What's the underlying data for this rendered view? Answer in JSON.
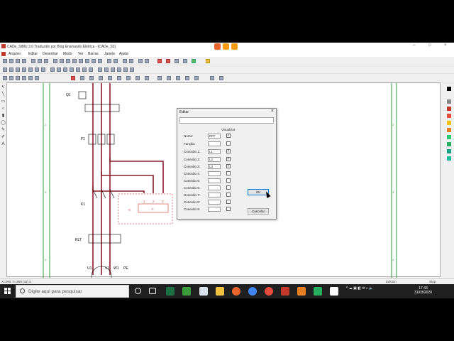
{
  "window": {
    "title": "CADe_SIMU 3.0 Traduzido por Blog Ensinando Elétrica - [CADe_S3]",
    "minimize": "–",
    "maximize": "□",
    "close": "×"
  },
  "menu": [
    "Arquivo",
    "Editar",
    "Desenhar",
    "Modo",
    "Ver",
    "Barras",
    "Janela",
    "Ajuda"
  ],
  "schematic": {
    "labels": {
      "q1": "Q1",
      "f1": "F1",
      "k1": "K1",
      "rlt": "RLT",
      "pe": "PE",
      "u1": "U1",
      "v1": "V1",
      "w1": "W1",
      "k_coil": "-K",
      "f_box": "F",
      "p1": "1",
      "p2": "2",
      "p3": "3"
    }
  },
  "dialog": {
    "title": "Editar",
    "close": "×",
    "visualizar": "Visualizar",
    "rows": [
      {
        "label": "Nome:",
        "value": "RFF",
        "checked": true
      },
      {
        "label": "Função:",
        "value": "",
        "checked": false
      },
      {
        "label": "Conexão 1:",
        "value": "L1",
        "checked": true
      },
      {
        "label": "Conexão 2:",
        "value": "L2",
        "checked": true
      },
      {
        "label": "Conexão 3:",
        "value": "L3",
        "checked": true
      },
      {
        "label": "Conexão 4:",
        "value": "",
        "checked": false
      },
      {
        "label": "Conexão 5:",
        "value": "",
        "checked": false
      },
      {
        "label": "Conexão 6:",
        "value": "",
        "checked": false
      },
      {
        "label": "Conexão 7:",
        "value": "",
        "checked": false
      },
      {
        "label": "Conexão 8:",
        "value": "",
        "checked": false
      },
      {
        "label": "Conexão 9:",
        "value": "",
        "checked": false
      }
    ],
    "ok": "OK",
    "cancel": "Cancelar"
  },
  "status": {
    "coords": "X=290, Y=380 (41) 5",
    "mode": "Edición",
    "stop": "Stop"
  },
  "taskbar": {
    "search_placeholder": "Digite aqui para pesquisar",
    "time": "17:43",
    "date": "31/03/2020"
  },
  "colors": {
    "wire": "#8b1a2b",
    "grid": "#2a9d3a",
    "dashed": "#d9534f"
  }
}
